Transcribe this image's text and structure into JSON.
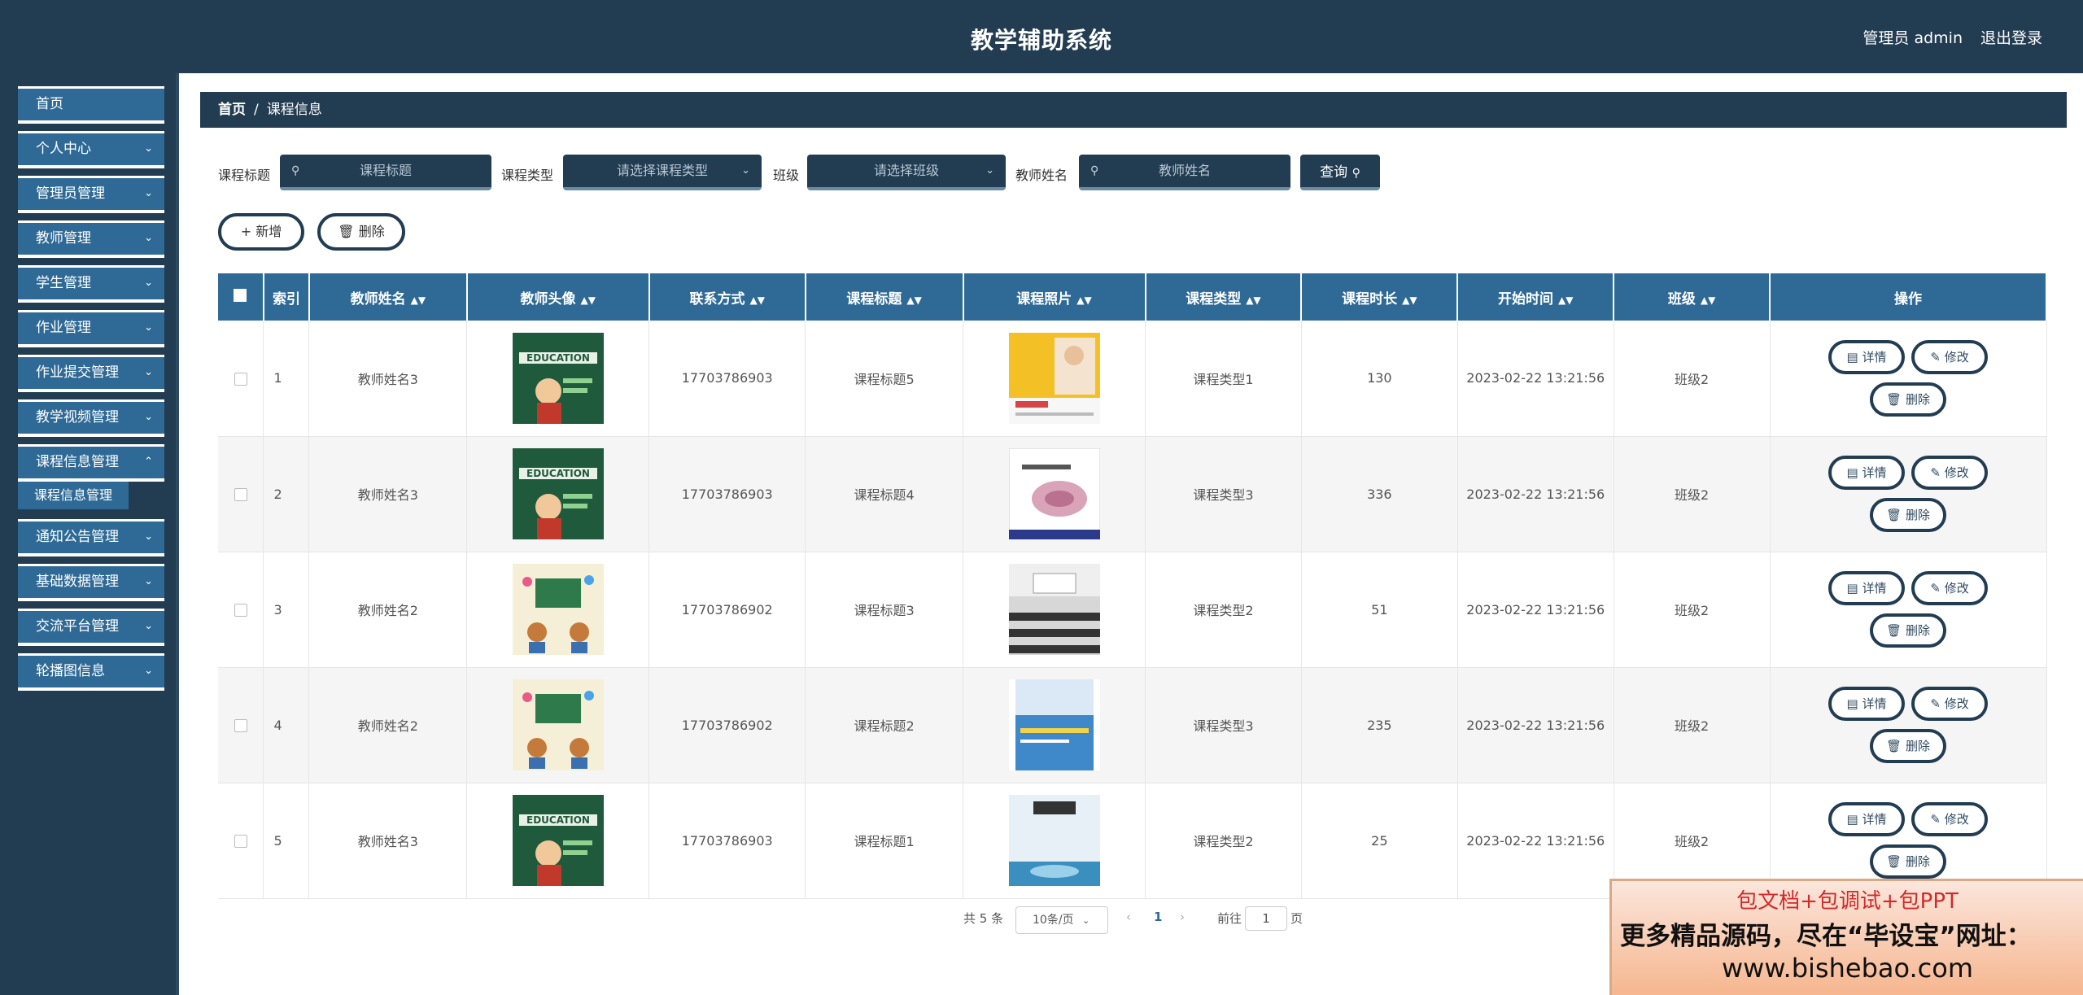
{
  "header": {
    "title": "教学辅助系统",
    "user": "管理员 admin",
    "logout": "退出登录"
  },
  "sidebar": {
    "items": [
      {
        "label": "首页"
      },
      {
        "label": "个人中心"
      },
      {
        "label": "管理员管理"
      },
      {
        "label": "教师管理"
      },
      {
        "label": "学生管理"
      },
      {
        "label": "作业管理"
      },
      {
        "label": "作业提交管理"
      },
      {
        "label": "教学视频管理"
      },
      {
        "label": "课程信息管理"
      },
      {
        "label": "通知公告管理"
      },
      {
        "label": "基础数据管理"
      },
      {
        "label": "交流平台管理"
      },
      {
        "label": "轮播图信息"
      }
    ],
    "sub_active": "课程信息管理"
  },
  "breadcrumb": {
    "home": "首页",
    "sep": "/",
    "current": "课程信息"
  },
  "search": {
    "title_label": "课程标题",
    "title_placeholder": "课程标题",
    "type_label": "课程类型",
    "type_placeholder": "请选择课程类型",
    "class_label": "班级",
    "class_placeholder": "请选择班级",
    "teacher_label": "教师姓名",
    "teacher_placeholder": "教师姓名",
    "query": "查询"
  },
  "actions": {
    "add": "新增",
    "delete": "删除"
  },
  "table": {
    "headers": [
      "索引",
      "教师姓名",
      "教师头像",
      "联系方式",
      "课程标题",
      "课程照片",
      "课程类型",
      "课程时长",
      "开始时间",
      "班级",
      "操作"
    ],
    "rows": [
      {
        "index": "1",
        "teacher": "教师姓名3",
        "phone": "17703786903",
        "title": "课程标题5",
        "type": "课程类型1",
        "duration": "130",
        "start": "2023-02-22 13:21:56",
        "class": "班级2"
      },
      {
        "index": "2",
        "teacher": "教师姓名3",
        "phone": "17703786903",
        "title": "课程标题4",
        "type": "课程类型3",
        "duration": "336",
        "start": "2023-02-22 13:21:56",
        "class": "班级2"
      },
      {
        "index": "3",
        "teacher": "教师姓名2",
        "phone": "17703786902",
        "title": "课程标题3",
        "type": "课程类型2",
        "duration": "51",
        "start": "2023-02-22 13:21:56",
        "class": "班级2"
      },
      {
        "index": "4",
        "teacher": "教师姓名2",
        "phone": "17703786902",
        "title": "课程标题2",
        "type": "课程类型3",
        "duration": "235",
        "start": "2023-02-22 13:21:56",
        "class": "班级2"
      },
      {
        "index": "5",
        "teacher": "教师姓名3",
        "phone": "17703786903",
        "title": "课程标题1",
        "type": "课程类型2",
        "duration": "25",
        "start": "2023-02-22 13:21:56",
        "class": "班级2"
      }
    ],
    "row_actions": {
      "detail": "详情",
      "edit": "修改",
      "delete": "删除"
    }
  },
  "pager": {
    "total": "共 5 条",
    "size": "10条/页",
    "current": "1",
    "goto": "前往",
    "goto_value": "1",
    "suffix": "页"
  },
  "ad": {
    "line1": "包文档+包调试+包PPT",
    "line2": "更多精品源码，尽在“毕设宝”网址：",
    "line3": "www.bishebao.com"
  },
  "colors": {
    "primary": "#223c52",
    "accent": "#2f6a96"
  }
}
